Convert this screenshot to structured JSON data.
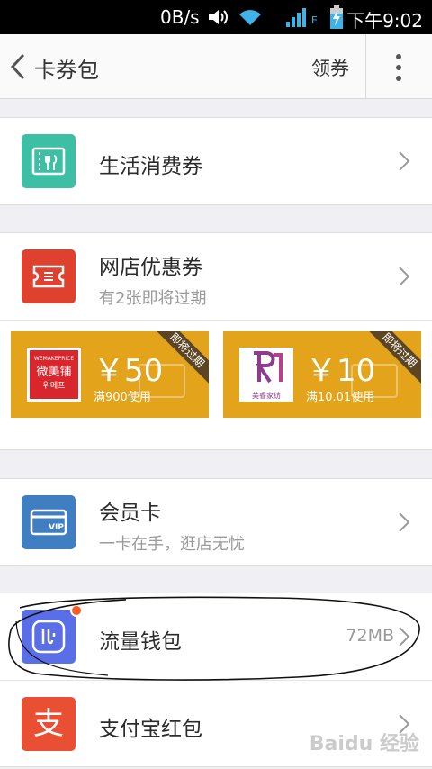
{
  "status_bar": {
    "net_speed": "0B/s",
    "time": "下午9:02",
    "icons": [
      "volume-icon",
      "wifi-icon",
      "signal-icon",
      "network-type-icon",
      "battery-charging-icon"
    ],
    "network_type": "E"
  },
  "header": {
    "title": "卡券包",
    "action_label": "领券"
  },
  "sections": {
    "life": {
      "title": "生活消费券"
    },
    "shop": {
      "title": "网店优惠券",
      "subtitle": "有2张即将过期",
      "coupons": [
        {
          "amount": "￥50",
          "condition": "满900使用",
          "ribbon": "即将过期",
          "logo_line1": "WEMAKEPRICE",
          "logo_line2": "微美铺",
          "logo_line3": "위메프"
        },
        {
          "amount": "￥10",
          "condition": "满10.01使用",
          "ribbon": "即将过期",
          "logo_line2": "美睿家纺"
        }
      ]
    },
    "member": {
      "title": "会员卡",
      "subtitle": "一卡在手，逛店无忧",
      "vip": "VIP"
    },
    "traffic": {
      "title": "流量钱包",
      "value": "72MB"
    },
    "alipay": {
      "title": "支付宝红包",
      "glyph": "支"
    }
  },
  "watermark": "Baidu 经验",
  "colors": {
    "life_icon": "#3dbfa4",
    "shop_icon": "#e0402e",
    "member_icon": "#3f7ec1",
    "traffic_icon": "#5a6ee8",
    "alipay_icon": "#e84f33",
    "coupon": "#e3a41b",
    "badge": "#ff5a1f"
  }
}
